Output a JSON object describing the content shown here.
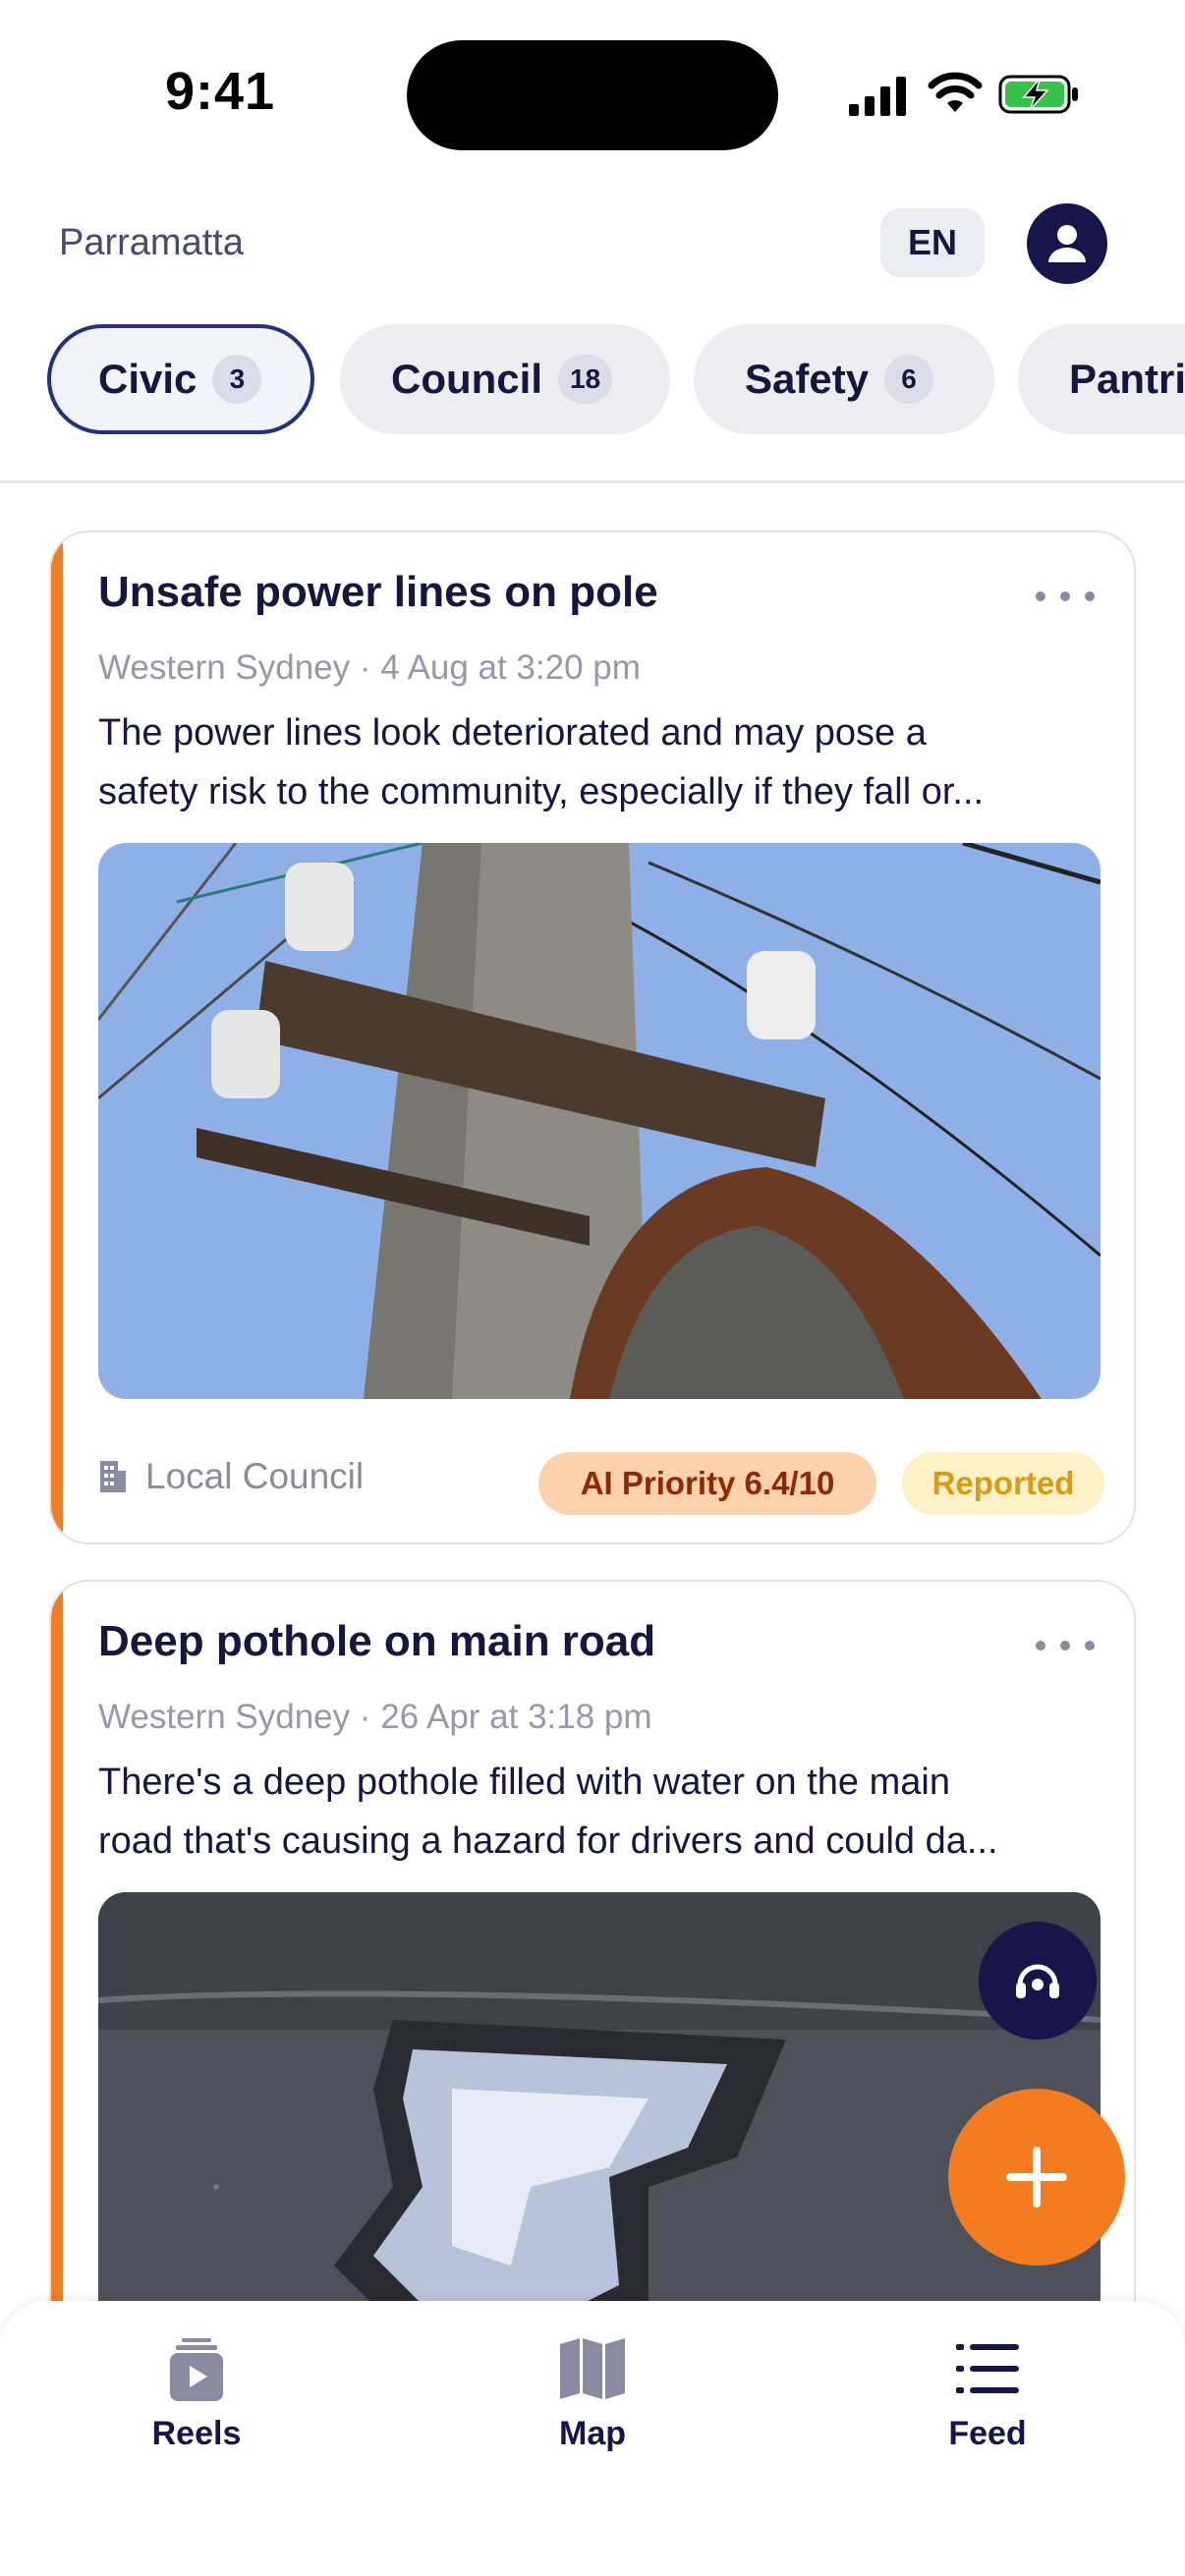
{
  "status_bar": {
    "time": "9:41"
  },
  "header": {
    "location": "Parramatta",
    "language": "EN",
    "profile_icon": "user-icon"
  },
  "tabs": [
    {
      "label": "Civic",
      "count": "3",
      "active": true
    },
    {
      "label": "Council",
      "count": "18",
      "active": false
    },
    {
      "label": "Safety",
      "count": "6",
      "active": false
    },
    {
      "label": "Pantri",
      "count": "",
      "active": false
    }
  ],
  "cards": [
    {
      "title": "Unsafe power lines on pole",
      "meta": "Western Sydney · 4 Aug at 3:20 pm",
      "description_line1": "The power lines look deteriorated and may pose a",
      "description_line2": "safety risk to the community, especially if they fall or...",
      "organization": "Local Council",
      "priority": "AI Priority 6.4/10",
      "status": "Reported",
      "accent_color": "#f47b20"
    },
    {
      "title": "Deep pothole on main road",
      "meta": "Western Sydney · 26 Apr at 3:18 pm",
      "description_line1": "There's a deep pothole filled with water on the main",
      "description_line2": "road that's causing a hazard for drivers and could da...",
      "accent_color": "#f47b20"
    }
  ],
  "fabs": {
    "support_icon": "headset-icon",
    "add_icon": "plus-icon"
  },
  "bottom_nav": [
    {
      "label": "Reels",
      "icon": "reels-icon"
    },
    {
      "label": "Map",
      "icon": "map-icon"
    },
    {
      "label": "Feed",
      "icon": "list-icon"
    }
  ],
  "colors": {
    "brand_navy": "#16164a",
    "accent_orange": "#f47b20"
  }
}
